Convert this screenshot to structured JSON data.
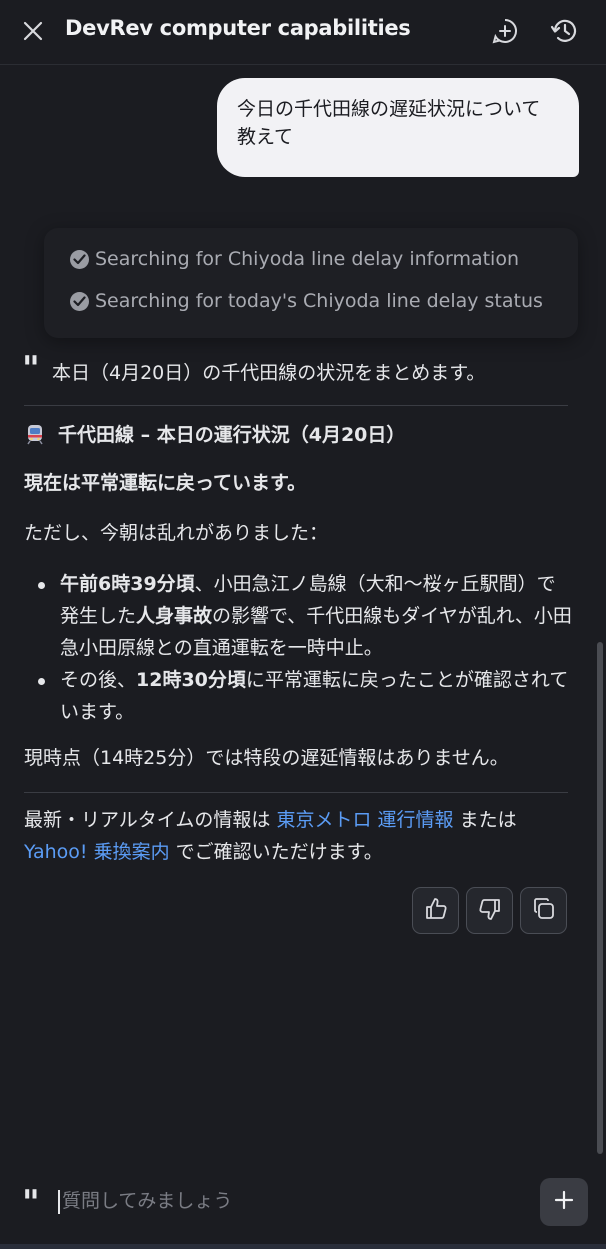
{
  "header": {
    "title": "DevRev computer capabilities"
  },
  "user_message": {
    "text": "今日の千代田線の遅延状況について教えて"
  },
  "steps": [
    {
      "label": "Searching for Chiyoda line delay information"
    },
    {
      "label": "Searching for today's Chiyoda line delay status"
    }
  ],
  "answer": {
    "summary": "本日（4月20日）の千代田線の状況をまとめます。",
    "section_title": "千代田線 – 本日の運行状況（4月20日）",
    "status_bold": "現在は平常運転に戻っています。",
    "intro": "ただし、今朝は乱れがありました：",
    "bullet1": {
      "b1": "午前6時39分頃",
      "t1": "、小田急江ノ島線（大和〜桜ヶ丘駅間）で発生した",
      "b2": "人身事故",
      "t2": "の影響で、千代田線もダイヤが乱れ、小田急小田原線との直通運転を一時中止。"
    },
    "bullet2": {
      "t1": "その後、",
      "b1": "12時30分頃",
      "t2": "に平常運転に戻ったことが確認されています。"
    },
    "current": "現時点（14時25分）では特段の遅延情報はありません。",
    "footer": {
      "t1": "最新・リアルタイムの情報は ",
      "link1": "東京メトロ 運行情報",
      "t2": " または ",
      "link2": "Yahoo! 乗換案内",
      "t3": " でご確認いただけます。"
    }
  },
  "composer": {
    "placeholder": "質問してみましょう"
  },
  "colors": {
    "background": "#1b1c21",
    "link": "#5b9cf5",
    "user_bubble": "#f2f2f5"
  }
}
